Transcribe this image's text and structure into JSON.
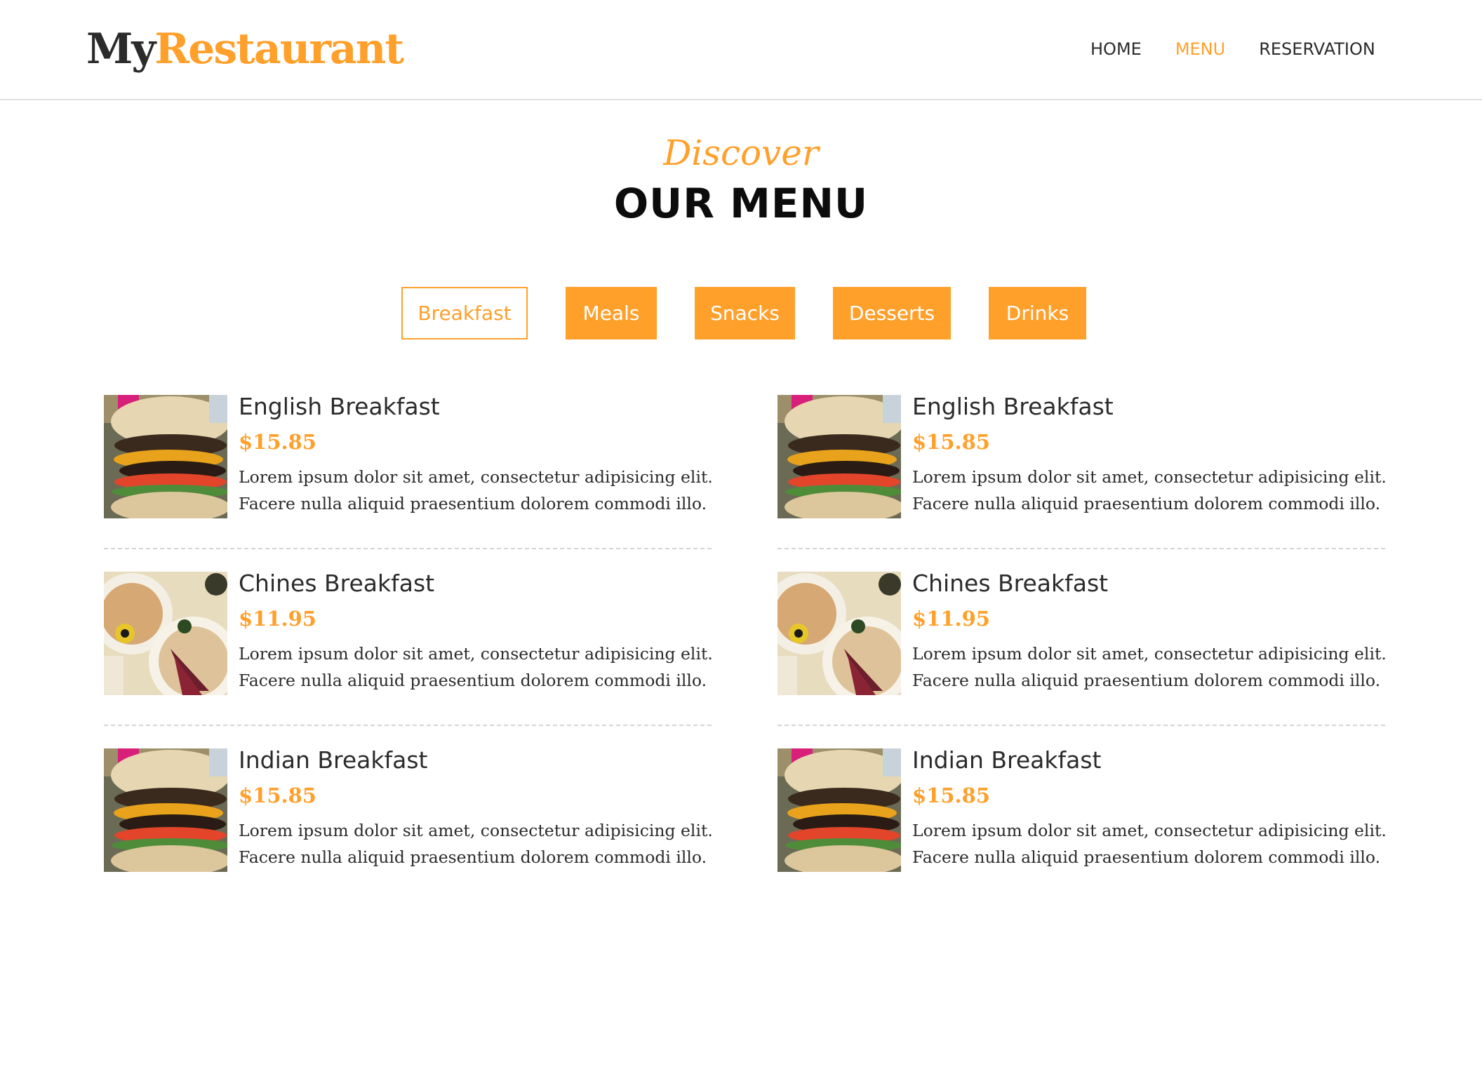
{
  "brand": {
    "part1": "My",
    "part2": "Restaurant"
  },
  "nav": [
    {
      "label": "HOME",
      "active": false
    },
    {
      "label": "MENU",
      "active": true
    },
    {
      "label": "RESERVATION",
      "active": false
    }
  ],
  "section": {
    "kicker": "Discover",
    "title": "OUR MENU"
  },
  "tabs": [
    {
      "label": "Breakfast",
      "active": true
    },
    {
      "label": "Meals",
      "active": false
    },
    {
      "label": "Snacks",
      "active": false
    },
    {
      "label": "Desserts",
      "active": false
    },
    {
      "label": "Drinks",
      "active": false
    }
  ],
  "menu": {
    "left": [
      {
        "name": "English Breakfast",
        "price": "$15.85",
        "desc1": "Lorem ipsum dolor sit amet, consectetur adipisicing elit.",
        "desc2": "Facere nulla aliquid praesentium dolorem commodi illo.",
        "image": "burger"
      },
      {
        "name": "Chines Breakfast",
        "price": "$11.95",
        "desc1": "Lorem ipsum dolor sit amet, consectetur adipisicing elit.",
        "desc2": "Facere nulla aliquid praesentium dolorem commodi illo.",
        "image": "plate"
      },
      {
        "name": "Indian Breakfast",
        "price": "$15.85",
        "desc1": "Lorem ipsum dolor sit amet, consectetur adipisicing elit.",
        "desc2": "Facere nulla aliquid praesentium dolorem commodi illo.",
        "image": "burger"
      }
    ],
    "right": [
      {
        "name": "English Breakfast",
        "price": "$15.85",
        "desc1": "Lorem ipsum dolor sit amet, consectetur adipisicing elit.",
        "desc2": "Facere nulla aliquid praesentium dolorem commodi illo.",
        "image": "burger"
      },
      {
        "name": "Chines Breakfast",
        "price": "$11.95",
        "desc1": "Lorem ipsum dolor sit amet, consectetur adipisicing elit.",
        "desc2": "Facere nulla aliquid praesentium dolorem commodi illo.",
        "image": "plate"
      },
      {
        "name": "Indian Breakfast",
        "price": "$15.85",
        "desc1": "Lorem ipsum dolor sit amet, consectetur adipisicing elit.",
        "desc2": "Facere nulla aliquid praesentium dolorem commodi illo.",
        "image": "burger"
      }
    ]
  },
  "colors": {
    "accent": "#ffa02b",
    "text": "#2b2b2b",
    "divider": "#d5d5d5"
  }
}
